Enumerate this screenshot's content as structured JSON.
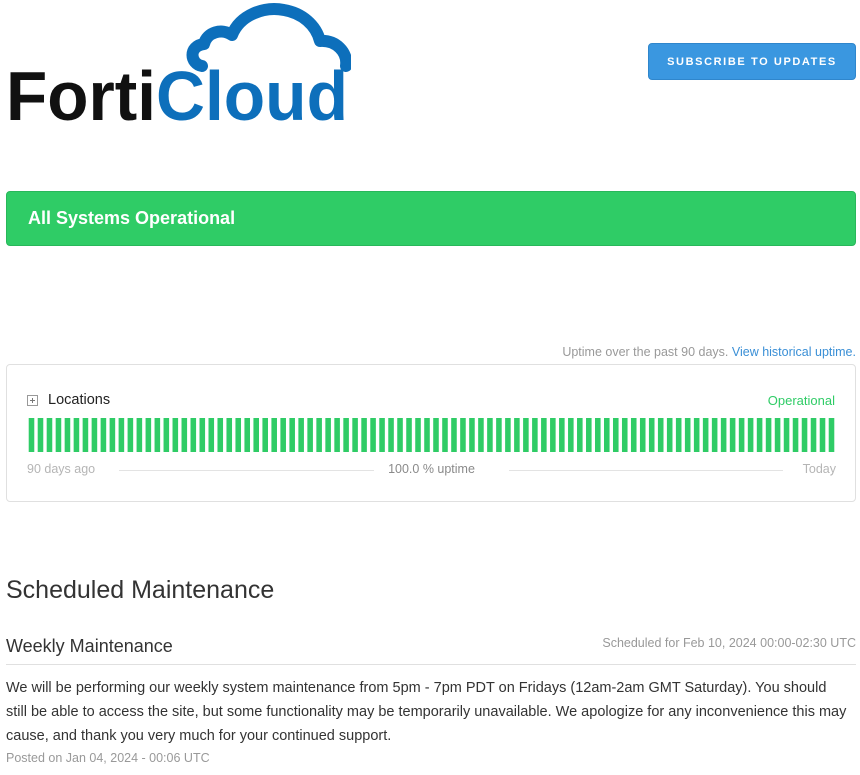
{
  "header": {
    "logo_text_dark": "Forti",
    "logo_text_blue": "Cloud",
    "subscribe_label": "SUBSCRIBE TO UPDATES"
  },
  "status": {
    "banner_text": "All Systems Operational"
  },
  "uptime": {
    "caption": "Uptime over the past 90 days.",
    "historical_link": "View historical uptime.",
    "component": {
      "name": "Locations",
      "status": "Operational",
      "range_start": "90 days ago",
      "range_center": "100.0 % uptime",
      "range_end": "Today",
      "day_count": 90,
      "uptime_percent": 100.0
    }
  },
  "maintenance": {
    "section_title": "Scheduled Maintenance",
    "title": "Weekly Maintenance",
    "scheduled": "Scheduled for Feb 10, 2024 00:00-02:30 UTC",
    "body": "We will be performing our weekly system maintenance from 5pm - 7pm PDT on Fridays (12am-2am GMT Saturday). You should still be able to access the site, but some functionality may be temporarily unavailable. We apologize for any inconvenience this may cause, and thank you very much for your continued support.",
    "posted": "Posted on Jan 04, 2024 - 00:06 UTC"
  },
  "colors": {
    "brand_blue": "#0d6fbb",
    "brand_dark": "#111111",
    "operational_green": "#2fcc66",
    "button_blue": "#3a97e0"
  },
  "icons": {
    "expand": "plus-square-icon",
    "logo_cloud": "cloud-icon"
  }
}
